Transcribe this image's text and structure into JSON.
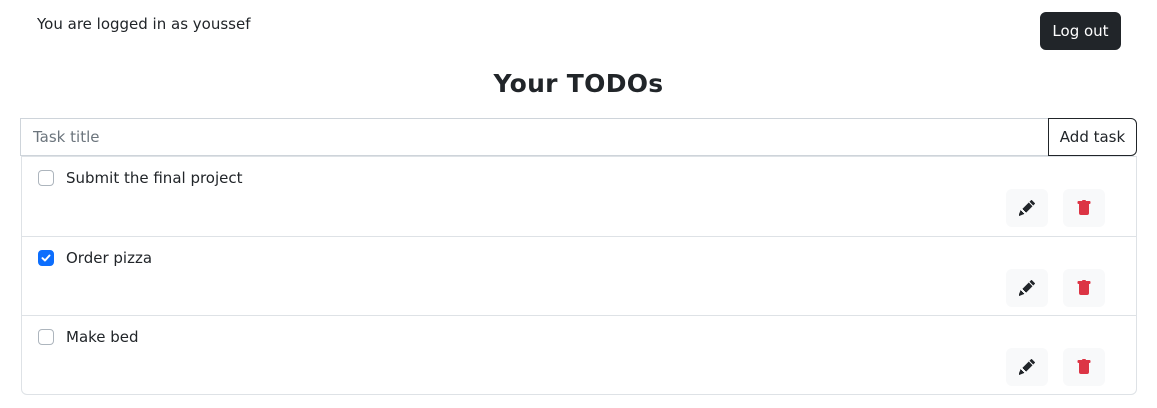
{
  "header": {
    "login_status": "You are logged in as youssef",
    "logout_label": "Log out"
  },
  "page": {
    "title": "Your TODOs"
  },
  "add_form": {
    "placeholder": "Task title",
    "value": "",
    "add_label": "Add task"
  },
  "tasks": [
    {
      "title": "Submit the final project",
      "done": false
    },
    {
      "title": "Order pizza",
      "done": true
    },
    {
      "title": "Make bed",
      "done": false
    }
  ],
  "icons": {
    "edit": "pencil-icon",
    "delete": "trash-icon",
    "checked": "checkmark-icon"
  },
  "colors": {
    "primary_dark": "#212529",
    "checkbox_checked": "#0d6efd",
    "delete_red": "#dc3545",
    "icon_button_bg": "#f8f9fa",
    "border": "#dee2e6"
  }
}
